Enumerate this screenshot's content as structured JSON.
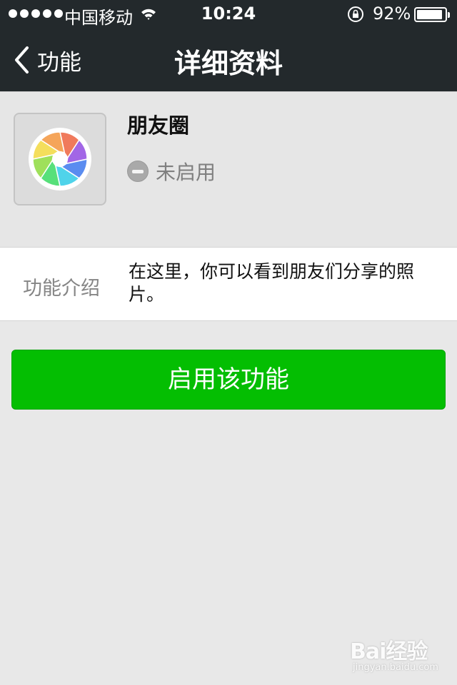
{
  "status_bar": {
    "carrier": "中国移动",
    "time": "10:24",
    "battery_percent": "92%",
    "battery_level": 0.92
  },
  "nav": {
    "back_label": "功能",
    "title": "详细资料"
  },
  "feature": {
    "icon": "moments-aperture-icon",
    "name": "朋友圈",
    "status": "未启用"
  },
  "intro": {
    "label": "功能介绍",
    "text": "在这里，你可以看到朋友们分享的照片。"
  },
  "actions": {
    "enable_label": "启用该功能"
  },
  "watermark": {
    "logo": "Bai经验",
    "url": "jingyan.baidu.com"
  },
  "colors": {
    "header_bg": "#23292c",
    "page_bg": "#e8e8e8",
    "button_green": "#04be02"
  }
}
